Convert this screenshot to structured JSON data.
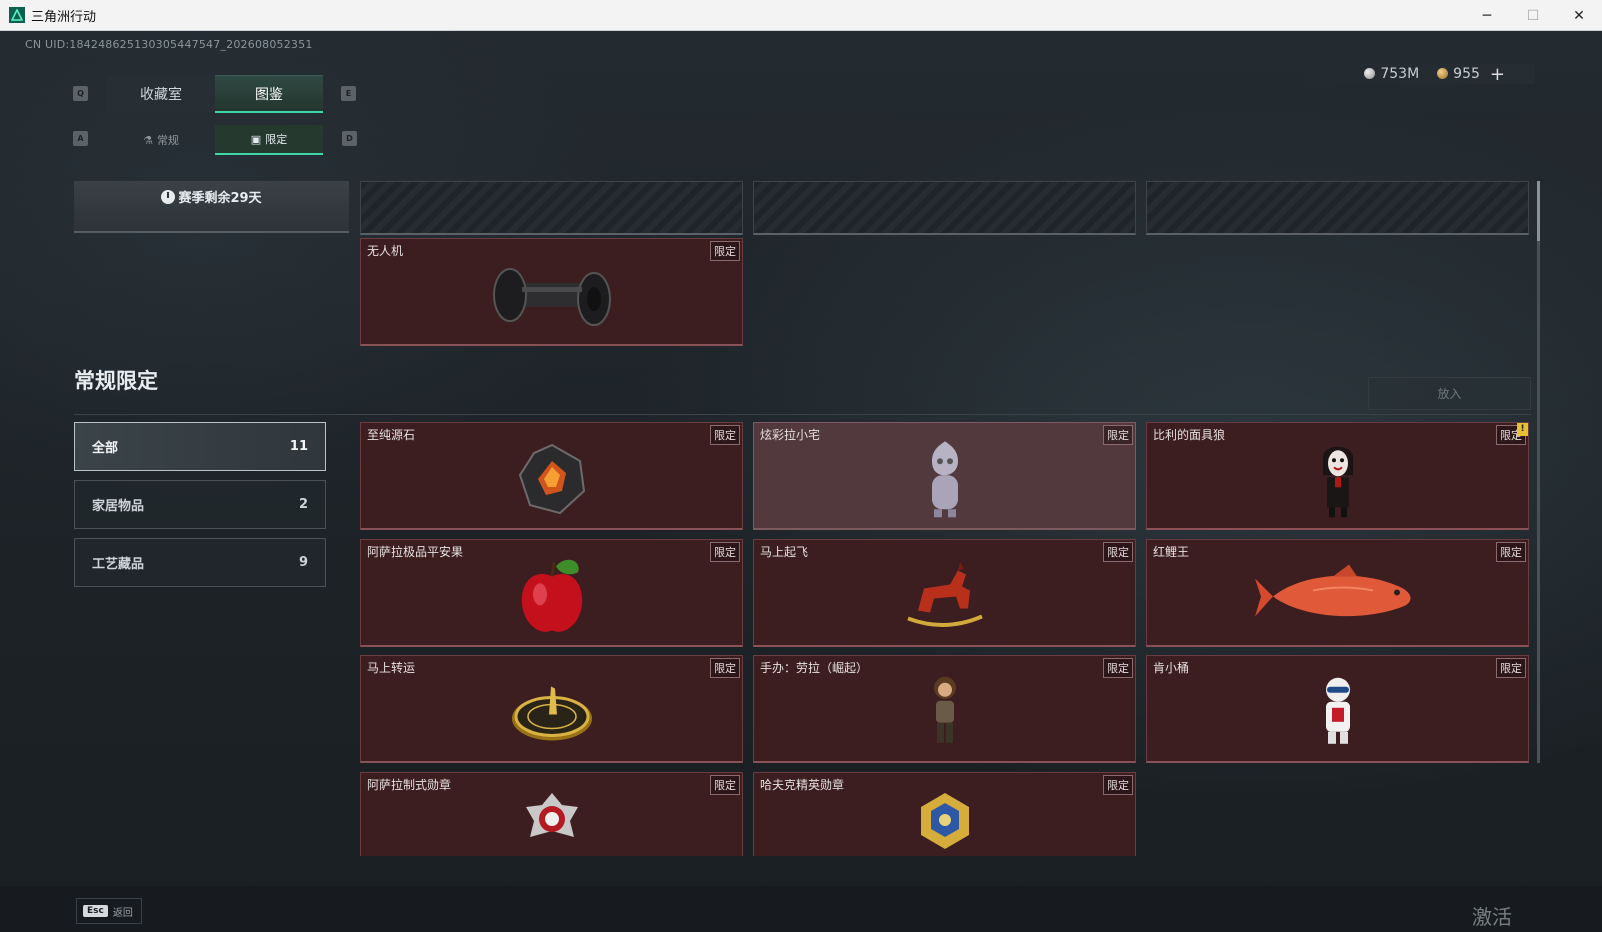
{
  "window": {
    "title": "三角洲行动",
    "icon": "delta-logo-icon",
    "controls": [
      "minimize-icon",
      "maximize-icon",
      "close-icon"
    ]
  },
  "header": {
    "uid": "CN UID:18424862513030544754​7_202608052351",
    "currency": {
      "silver": "753M",
      "gold": "955",
      "plus": "+"
    }
  },
  "tabs": {
    "main": [
      {
        "key": "Q",
        "label": "收藏室"
      },
      {
        "key": "E",
        "label": "图鉴"
      }
    ],
    "main_selected": "图鉴",
    "sub": [
      {
        "key": "A",
        "label": "常规"
      },
      {
        "key": "D",
        "label": "限定"
      }
    ],
    "sub_selected": "限定"
  },
  "season": {
    "text": "赛季剩余29天"
  },
  "featured": {
    "name": "无人机",
    "tag": "限定",
    "icon": "drone-tread-icon"
  },
  "section": {
    "title": "常规限定",
    "put_button": "放入"
  },
  "filters": [
    {
      "label": "全部",
      "count": "11"
    },
    {
      "label": "家居物品",
      "count": "2"
    },
    {
      "label": "工艺藏品",
      "count": "9"
    }
  ],
  "items": [
    {
      "name": "至纯源石",
      "tag": "限定",
      "icon": "ore-crystal-icon"
    },
    {
      "name": "炫彩拉小宅",
      "tag": "限定",
      "icon": "doll-figure-icon"
    },
    {
      "name": "比利的面具狼",
      "tag": "限定",
      "icon": "puppet-mask-icon",
      "warning": "!"
    },
    {
      "name": "阿萨拉极品平安果",
      "tag": "限定",
      "icon": "apple-icon"
    },
    {
      "name": "马上起飞",
      "tag": "限定",
      "icon": "rocking-horse-icon"
    },
    {
      "name": "红鲤王",
      "tag": "限定",
      "icon": "carp-fish-icon"
    },
    {
      "name": "马上转运",
      "tag": "限定",
      "icon": "gold-compass-icon"
    },
    {
      "name": "手办：劳拉（崛起）",
      "tag": "限定",
      "icon": "figure-lara-icon"
    },
    {
      "name": "肯小桶",
      "tag": "限定",
      "icon": "bucket-mascot-icon"
    },
    {
      "name": "阿萨拉制式勋章",
      "tag": "限定",
      "icon": "medal-red-icon"
    },
    {
      "name": "哈夫克精英勋章",
      "tag": "限定",
      "icon": "medal-gold-icon"
    }
  ],
  "footer": {
    "esc_key": "Esc",
    "back_label": "返回",
    "watermark": "激活 Windows"
  },
  "colors": {
    "accent": "#3fd7a8",
    "card_bg": "#3c1d20",
    "card_highlight": "#52393d"
  }
}
